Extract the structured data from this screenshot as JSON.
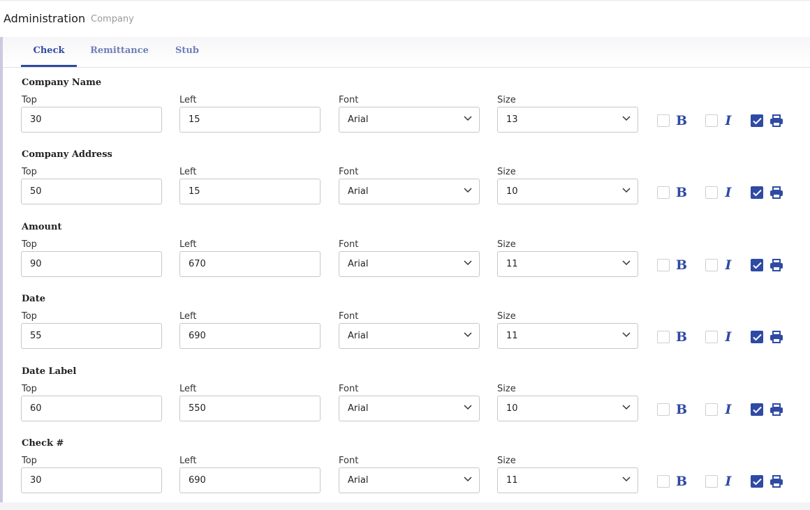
{
  "header": {
    "title": "Administration",
    "breadcrumb": "Company"
  },
  "tabs": [
    {
      "label": "Check",
      "active": true
    },
    {
      "label": "Remittance",
      "active": false
    },
    {
      "label": "Stub",
      "active": false
    }
  ],
  "labels": {
    "top": "Top",
    "left": "Left",
    "font": "Font",
    "size": "Size"
  },
  "icons": {
    "bold": "B",
    "italic": "I",
    "print": "printer-icon"
  },
  "colors": {
    "accent": "#2f4aa4"
  },
  "fields": [
    {
      "name": "Company Name",
      "top": "30",
      "left": "15",
      "font": "Arial",
      "size": "13",
      "bold": false,
      "italic": false,
      "print": true
    },
    {
      "name": "Company Address",
      "top": "50",
      "left": "15",
      "font": "Arial",
      "size": "10",
      "bold": false,
      "italic": false,
      "print": true
    },
    {
      "name": "Amount",
      "top": "90",
      "left": "670",
      "font": "Arial",
      "size": "11",
      "bold": false,
      "italic": false,
      "print": true
    },
    {
      "name": "Date",
      "top": "55",
      "left": "690",
      "font": "Arial",
      "size": "11",
      "bold": false,
      "italic": false,
      "print": true
    },
    {
      "name": "Date Label",
      "top": "60",
      "left": "550",
      "font": "Arial",
      "size": "10",
      "bold": false,
      "italic": false,
      "print": true
    },
    {
      "name": "Check #",
      "top": "30",
      "left": "690",
      "font": "Arial",
      "size": "11",
      "bold": false,
      "italic": false,
      "print": true
    }
  ]
}
